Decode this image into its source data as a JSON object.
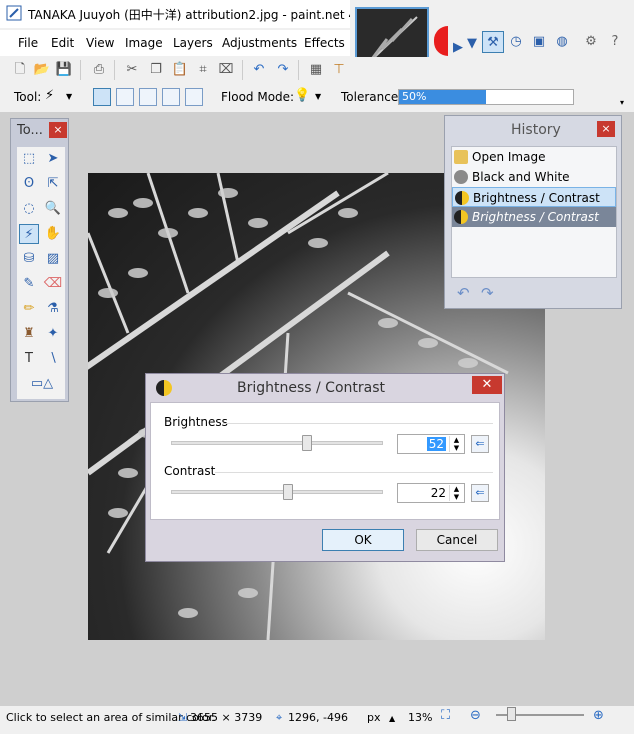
{
  "window": {
    "title": "TANAKA Juuyoh (田中十洋) attribution2.jpg - paint.net 4.0.5",
    "minimize": "—",
    "maximize": "□",
    "close": "✕"
  },
  "menu": [
    "File",
    "Edit",
    "View",
    "Image",
    "Layers",
    "Adjustments",
    "Effects"
  ],
  "tool_options": {
    "tool_label": "Tool:",
    "flood_mode_label": "Flood Mode:",
    "tolerance_label": "Tolerance:",
    "tolerance_value": "50%",
    "tolerance_fraction": 0.5
  },
  "tools_window": {
    "title": "To...",
    "close": "×"
  },
  "history_window": {
    "title": "History",
    "close": "×",
    "items": [
      {
        "label": "Open Image",
        "state": "normal",
        "color": "#e8c25a"
      },
      {
        "label": "Black and White",
        "state": "normal",
        "color": "#8a8a8a"
      },
      {
        "label": "Brightness / Contrast",
        "state": "selected",
        "color": "#f3c623"
      },
      {
        "label": "Brightness / Contrast",
        "state": "redo",
        "color": "#f3c623"
      }
    ]
  },
  "dialog": {
    "title": "Brightness / Contrast",
    "close": "✕",
    "brightness_label": "Brightness",
    "brightness_value": "52",
    "brightness_level": 0.64,
    "contrast_label": "Contrast",
    "contrast_value": "22",
    "contrast_level": 0.55,
    "ok_label": "OK",
    "cancel_label": "Cancel"
  },
  "statusbar": {
    "hint": "Click to select an area of similar color.",
    "image_size": "3655 × 3739",
    "cursor_pos": "1296, -496",
    "units": "px",
    "zoom": "13%"
  },
  "colors": {
    "accent": "#3b8de0",
    "close": "#c7392f",
    "selection": "#cde3f7"
  }
}
